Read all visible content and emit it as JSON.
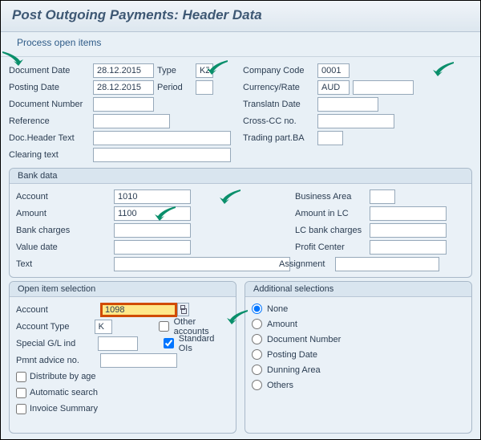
{
  "title": "Post Outgoing Payments: Header Data",
  "process_link": "Process open items",
  "header": {
    "doc_date_lbl": "Document Date",
    "doc_date": "28.12.2015",
    "type_lbl": "Type",
    "type": "KZ",
    "company_code_lbl": "Company Code",
    "company_code": "0001",
    "posting_date_lbl": "Posting Date",
    "posting_date": "28.12.2015",
    "period_lbl": "Period",
    "period": "",
    "curr_lbl": "Currency/Rate",
    "curr": "AUD",
    "rate": "",
    "doc_no_lbl": "Document Number",
    "doc_no": "",
    "trans_lbl": "Translatn Date",
    "trans_date": "",
    "ref_lbl": "Reference",
    "ref": "",
    "cross_lbl": "Cross-CC no.",
    "cross": "",
    "dh_lbl": "Doc.Header Text",
    "dh": "",
    "tp_lbl": "Trading part.BA",
    "tp": "",
    "clr_lbl": "Clearing text",
    "clr": ""
  },
  "bank": {
    "title": "Bank data",
    "account_lbl": "Account",
    "account": "1010",
    "busarea_lbl": "Business Area",
    "busarea": "",
    "amount_lbl": "Amount",
    "amount": "1100",
    "amount_lc_lbl": "Amount in LC",
    "amount_lc": "",
    "charges_lbl": "Bank charges",
    "charges": "",
    "lc_charges_lbl": "LC bank charges",
    "lc_charges": "",
    "value_date_lbl": "Value date",
    "value_date": "",
    "profit_lbl": "Profit Center",
    "profit": "",
    "text_lbl": "Text",
    "text": "",
    "assign_lbl": "Assignment",
    "assign": ""
  },
  "open_item": {
    "title": "Open item selection",
    "account_lbl": "Account",
    "account": "1098",
    "other_lbl": "Other accounts",
    "acct_type_lbl": "Account Type",
    "acct_type": "K",
    "std_ois_lbl": "Standard OIs",
    "spec_gl_lbl": "Special G/L ind",
    "spec_gl": "",
    "advice_lbl": "Pmnt advice no.",
    "advice": "",
    "dist_lbl": "Distribute by age",
    "auto_lbl": "Automatic search",
    "inv_lbl": "Invoice Summary"
  },
  "addl": {
    "title": "Additional selections",
    "none": "None",
    "amount": "Amount",
    "docnum": "Document Number",
    "postdate": "Posting Date",
    "dun": "Dunning Area",
    "others": "Others"
  }
}
